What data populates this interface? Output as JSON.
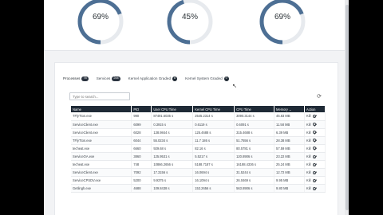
{
  "gauges": [
    {
      "label": "69%",
      "value": 0.69
    },
    {
      "label": "45%",
      "value": 0.45
    },
    {
      "label": "69%",
      "value": 0.69
    }
  ],
  "colors": {
    "gauge": "#4d6f94",
    "gauge_track": "#e7eaee",
    "header": "#1f2a36"
  },
  "tabs": [
    {
      "label": "Processes",
      "count": "76"
    },
    {
      "label": "Services",
      "count": "244"
    },
    {
      "label": "Kernel Application Graded",
      "count": "8"
    },
    {
      "label": "Kernel System Graded",
      "count": "0"
    }
  ],
  "search": {
    "placeholder": "Type to search..."
  },
  "table": {
    "headers": [
      "Name",
      "PID",
      "User CPU Time",
      "Kernel CPU Time",
      "CPU Time",
      "Memory",
      "Action"
    ],
    "rows": [
      [
        "TFlyTton.exe",
        "990",
        "87491.6035 s",
        "2545.2314 s",
        "3090.3144 s",
        "45.83 MB"
      ],
      [
        "ServiceClient.exe",
        "6099",
        "0.3915 s",
        "0.6119 s",
        "0.6091 s",
        "11.58 MB"
      ],
      [
        "ServiceClient.exe",
        "6028",
        "138.9844 s",
        "125.4688 s",
        "315.4688 s",
        "6.39 MB"
      ],
      [
        "TFlyTton.exe",
        "6044",
        "55.0234 s",
        "11.7 186 s",
        "51.7556 s",
        "28.38 MB"
      ],
      [
        "techeat.exe",
        "6660",
        "929.68 s",
        "82.16 s",
        "80.5781 s",
        "57.59 MB"
      ],
      [
        "ServiceOA.exe",
        "3860",
        "125.9531 s",
        "5.5217 s",
        "120.8906 s",
        "23.22 MB"
      ],
      [
        "techeat.exe",
        "748",
        "10866.2656 s",
        "5188.7187 s",
        "16188.4336 s",
        "25.24 MB"
      ],
      [
        "ServiceClient.exe",
        "7092",
        "17.3156 s",
        "16.0694 s",
        "31.5244 s",
        "12.72 MB"
      ],
      [
        "ServiceCPSDV.exe",
        "5200",
        "9.9375 s",
        "16.1094 s",
        "26.0469 s",
        "9.95 MB"
      ],
      [
        "Getlingh.exe",
        "4688",
        "109.8438 s",
        "153.2656 s",
        "563.8906 s",
        "9.80 MB"
      ]
    ],
    "action_label": "Kill"
  }
}
